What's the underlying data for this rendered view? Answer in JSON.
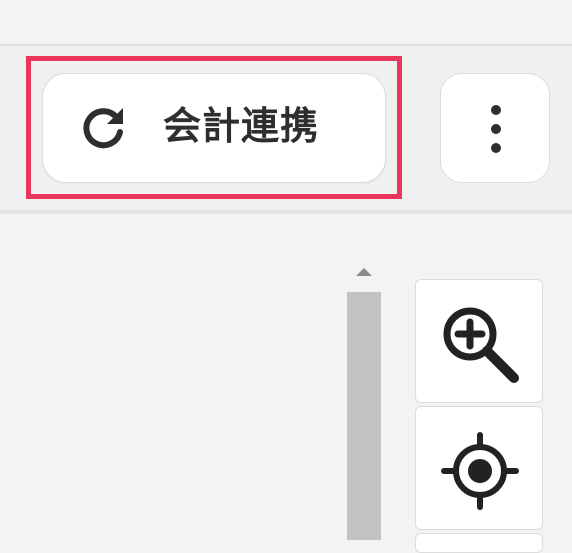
{
  "toolbar": {
    "sync_button_label": "会計連携",
    "sync_icon": "refresh-icon",
    "more_icon": "vertical-dots-icon",
    "highlight_color": "#e8365d"
  },
  "map_controls": {
    "zoom_in_icon": "zoom-in-icon",
    "locate_icon": "locate-icon"
  },
  "scrollbar": {
    "up_arrow_icon": "triangle-up-icon"
  }
}
